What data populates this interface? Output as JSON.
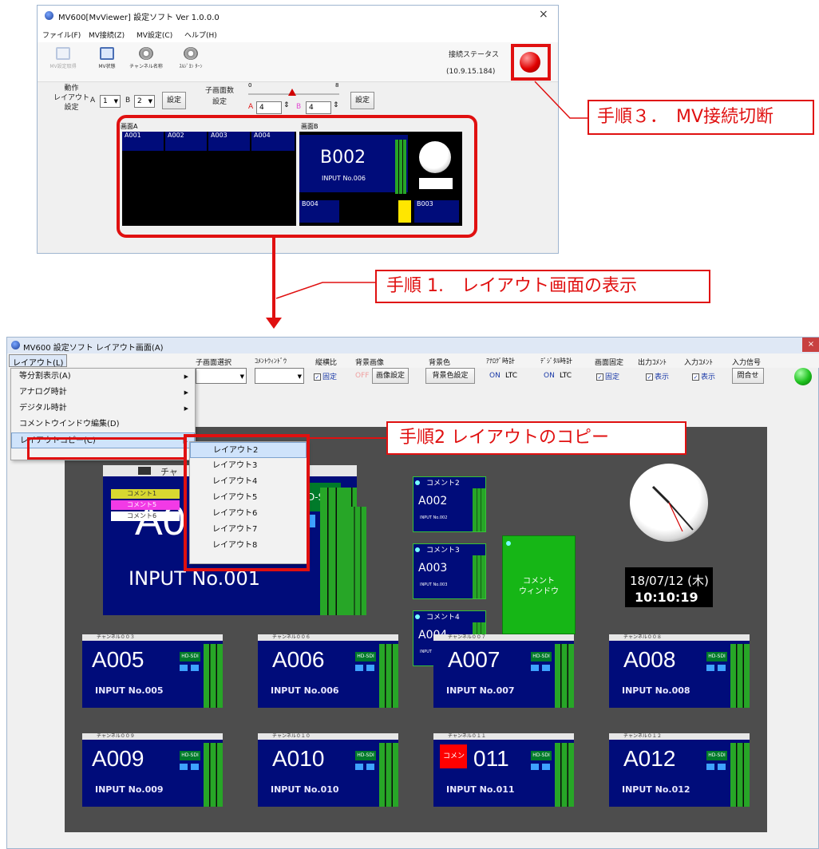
{
  "top_window": {
    "title": "MV600[MvViewer] 設定ソフト Ver 1.0.0.0",
    "close": "×",
    "menu": [
      "ファイル(F)",
      "MV接続(Z)",
      "MV設定(C)",
      "ヘルプ(H)"
    ],
    "toolbar": {
      "buttons": [
        "MV設定取得",
        "MV状態",
        "チャンネル名称",
        "ｽﾙｼﾞﾖﾝ ﾀｰﾝ"
      ],
      "status_label": "接続ステータス",
      "status_ip": "(10.9.15.184)",
      "status_color": "#e00000"
    },
    "layout_settings": {
      "label_lines": [
        "動作",
        "レイアウト",
        "設定"
      ],
      "a_label": "A",
      "a_value": "1",
      "b_label": "B",
      "b_value": "2",
      "set_button": "設定"
    },
    "child_count": {
      "label_lines": [
        "子画面数",
        "設定"
      ],
      "min": "0",
      "max": "8",
      "a_label": "A",
      "a_value": "4",
      "b_label": "B",
      "b_value": "4",
      "set_button": "設定"
    },
    "preview": {
      "a_label": "画面A",
      "b_label": "画面B",
      "a_tiles": [
        "A001",
        "A002",
        "A003",
        "A004"
      ],
      "b_main": "B002",
      "b_main_input": "INPUT No.006",
      "b_small": [
        "B004",
        "B003"
      ]
    }
  },
  "callouts": {
    "step3": "手順３．　MV接続切断",
    "step1": "手順 1.　レイアウト画面の表示",
    "step2": "手順2  レイアウトのコピー"
  },
  "bottom_window": {
    "title": "MV600 設定ソフト レイアウト画面(A)",
    "close": "×",
    "menu_button": "レイアウト(L)",
    "controls": [
      {
        "header": "子画面選択",
        "value": ""
      },
      {
        "header": "ｺﾒﾝﾄｳｨﾝﾄﾞｳ",
        "value": ""
      },
      {
        "header": "縦横比",
        "value": "固定"
      },
      {
        "header": "背景画像",
        "off": "OFF",
        "button": "画像設定"
      },
      {
        "header": "背景色",
        "button": "背景色設定"
      },
      {
        "header": "ｱﾅﾛｸﾞ時計",
        "on": "ON",
        "extra": "LTC"
      },
      {
        "header": "ﾃﾞｼﾞﾀﾙ時計",
        "on": "ON",
        "extra": "LTC"
      },
      {
        "header": "画面固定",
        "value": "固定"
      },
      {
        "header": "出力ｺﾒﾝﾄ",
        "value": "表示"
      },
      {
        "header": "入力ｺﾒﾝﾄ",
        "value": "表示"
      },
      {
        "header": "入力信号",
        "button": "問合せ"
      }
    ],
    "status_color": "#1ec11e",
    "layout_menu": {
      "items": [
        "等分割表示(A)",
        "アナログ時計",
        "デジタル時計",
        "コメントウインドウ編集(D)",
        "レイアウトコピー(C)"
      ],
      "submenu": [
        "レイアウト2",
        "レイアウト3",
        "レイアウト4",
        "レイアウト5",
        "レイアウト6",
        "レイアウト7",
        "レイアウト8"
      ]
    },
    "main_tile": {
      "input": "INPUT No.001",
      "code_partial": "A0",
      "channel": "チャ",
      "hd_partial": "D-SDI",
      "g2": "G2",
      "comments": [
        "コメント1",
        "コメント5",
        "コメント6"
      ]
    },
    "small_tiles": [
      {
        "comment": "コメント2",
        "code": "A002",
        "input": "INPUT No.002"
      },
      {
        "comment": "コメント3",
        "code": "A003",
        "input": "INPUT No.003"
      },
      {
        "comment": "コメント4",
        "code": "A004",
        "input": "INPUT No.004"
      }
    ],
    "comment_window": [
      "コメント",
      "ウィンドウ"
    ],
    "digital_clock": {
      "date": "18/07/12 (木)",
      "time": "10:10:19"
    },
    "grid_tiles": [
      {
        "channel": "チャンネル００３",
        "code": "A005",
        "input": "INPUT No.005"
      },
      {
        "channel": "チャンネル００６",
        "code": "A006",
        "input": "INPUT No.006"
      },
      {
        "channel": "チャンネル００７",
        "code": "A007",
        "input": "INPUT No.007"
      },
      {
        "channel": "チャンネル００８",
        "code": "A008",
        "input": "INPUT No.008"
      },
      {
        "channel": "チャンネル００９",
        "code": "A009",
        "input": "INPUT No.009"
      },
      {
        "channel": "チャンネル０１０",
        "code": "A010",
        "input": "INPUT No.010"
      },
      {
        "channel": "チャンネル０１１",
        "code": "011",
        "input": "INPUT No.011",
        "overlay": "コメン"
      },
      {
        "channel": "チャンネル０１２",
        "code": "A012",
        "input": "INPUT No.012"
      }
    ],
    "hd_label": "HD-SDI"
  }
}
